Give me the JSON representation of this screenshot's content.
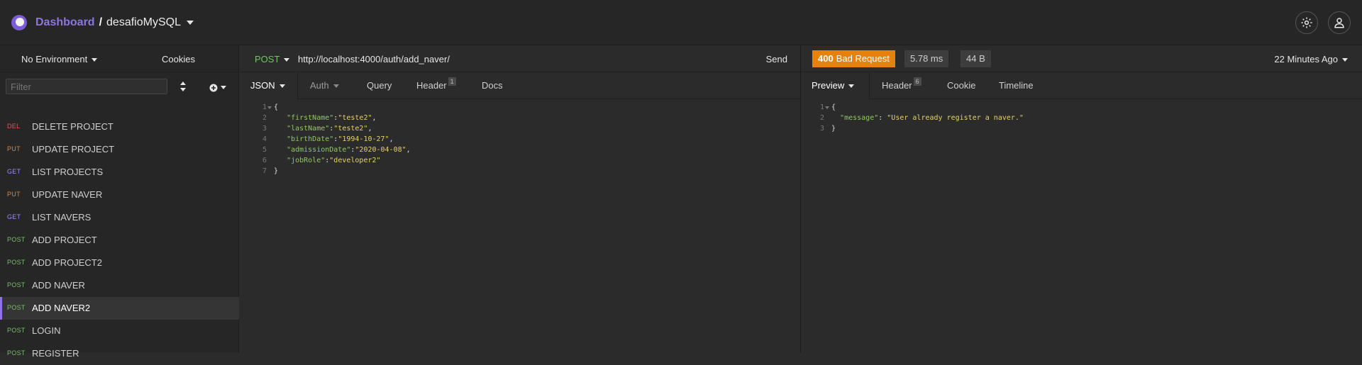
{
  "header": {
    "dashboard_label": "Dashboard",
    "separator": "/",
    "project_name": "desafioMySQL"
  },
  "sidebar": {
    "environment": "No Environment",
    "cookies_label": "Cookies",
    "filter_placeholder": "Filter",
    "requests": [
      {
        "method": "DEL",
        "name": "DELETE PROJECT",
        "color": "#e05c4a"
      },
      {
        "method": "PUT",
        "name": "UPDATE PROJECT",
        "color": "#e2873b"
      },
      {
        "method": "GET",
        "name": "LIST PROJECTS",
        "color": "#a58ae8"
      },
      {
        "method": "PUT",
        "name": "UPDATE NAVER",
        "color": "#e2873b"
      },
      {
        "method": "GET",
        "name": "LIST NAVERS",
        "color": "#a58ae8"
      },
      {
        "method": "POST",
        "name": "ADD PROJECT",
        "color": "#74c365"
      },
      {
        "method": "POST",
        "name": "ADD PROJECT2",
        "color": "#74c365"
      },
      {
        "method": "POST",
        "name": "ADD NAVER",
        "color": "#74c365"
      },
      {
        "method": "POST",
        "name": "ADD NAVER2",
        "color": "#74c365",
        "active": true
      },
      {
        "method": "POST",
        "name": "LOGIN",
        "color": "#74c365"
      },
      {
        "method": "POST",
        "name": "REGISTER",
        "color": "#74c365"
      }
    ]
  },
  "request": {
    "method": "POST",
    "url": "http://localhost:4000/auth/add_naver/",
    "send_label": "Send",
    "tabs": {
      "body": "JSON",
      "auth": "Auth",
      "query": "Query",
      "header": "Header",
      "header_count": "1",
      "docs": "Docs"
    },
    "body_lines": [
      {
        "n": "1",
        "fold": true,
        "parts": [
          {
            "t": "{",
            "c": "p"
          }
        ]
      },
      {
        "n": "2",
        "parts": [
          {
            "t": "   ",
            "c": "p"
          },
          {
            "t": "\"firstName\"",
            "c": "k"
          },
          {
            "t": ":",
            "c": "p"
          },
          {
            "t": "\"teste2\"",
            "c": "s"
          },
          {
            "t": ",",
            "c": "p"
          }
        ]
      },
      {
        "n": "3",
        "parts": [
          {
            "t": "   ",
            "c": "p"
          },
          {
            "t": "\"lastName\"",
            "c": "k"
          },
          {
            "t": ":",
            "c": "p"
          },
          {
            "t": "\"teste2\"",
            "c": "s"
          },
          {
            "t": ",",
            "c": "p"
          }
        ]
      },
      {
        "n": "4",
        "parts": [
          {
            "t": "   ",
            "c": "p"
          },
          {
            "t": "\"birthDate\"",
            "c": "k"
          },
          {
            "t": ":",
            "c": "p"
          },
          {
            "t": "\"1994-10-27\"",
            "c": "s"
          },
          {
            "t": ",",
            "c": "p"
          }
        ]
      },
      {
        "n": "5",
        "parts": [
          {
            "t": "   ",
            "c": "p"
          },
          {
            "t": "\"admissionDate\"",
            "c": "k"
          },
          {
            "t": ":",
            "c": "p"
          },
          {
            "t": "\"2020-04-08\"",
            "c": "s"
          },
          {
            "t": ",",
            "c": "p"
          }
        ]
      },
      {
        "n": "6",
        "parts": [
          {
            "t": "   ",
            "c": "p"
          },
          {
            "t": "\"jobRole\"",
            "c": "k"
          },
          {
            "t": ":",
            "c": "p"
          },
          {
            "t": "\"developer2\"",
            "c": "s"
          }
        ]
      },
      {
        "n": "7",
        "parts": [
          {
            "t": "}",
            "c": "p"
          }
        ]
      }
    ]
  },
  "response": {
    "status_code": "400",
    "status_text": "Bad Request",
    "time": "5.78 ms",
    "size": "44 B",
    "time_ago": "22 Minutes Ago",
    "tabs": {
      "preview": "Preview",
      "header": "Header",
      "header_count": "6",
      "cookie": "Cookie",
      "timeline": "Timeline"
    },
    "body_lines": [
      {
        "n": "1",
        "fold": true,
        "parts": [
          {
            "t": "{",
            "c": "p"
          }
        ]
      },
      {
        "n": "2",
        "parts": [
          {
            "t": "  ",
            "c": "p"
          },
          {
            "t": "\"message\"",
            "c": "k"
          },
          {
            "t": ": ",
            "c": "p"
          },
          {
            "t": "\"User already register a naver.\"",
            "c": "s"
          }
        ]
      },
      {
        "n": "3",
        "parts": [
          {
            "t": "}",
            "c": "p"
          }
        ]
      }
    ]
  },
  "colors": {
    "accent": "#8e74e0",
    "status_error": "#e6810c",
    "method_post": "#74c365"
  },
  "icons": [
    "gear-icon",
    "user-icon",
    "sort-icon",
    "add-circle-icon",
    "chevron-down-icon",
    "fold-arrow-icon"
  ]
}
